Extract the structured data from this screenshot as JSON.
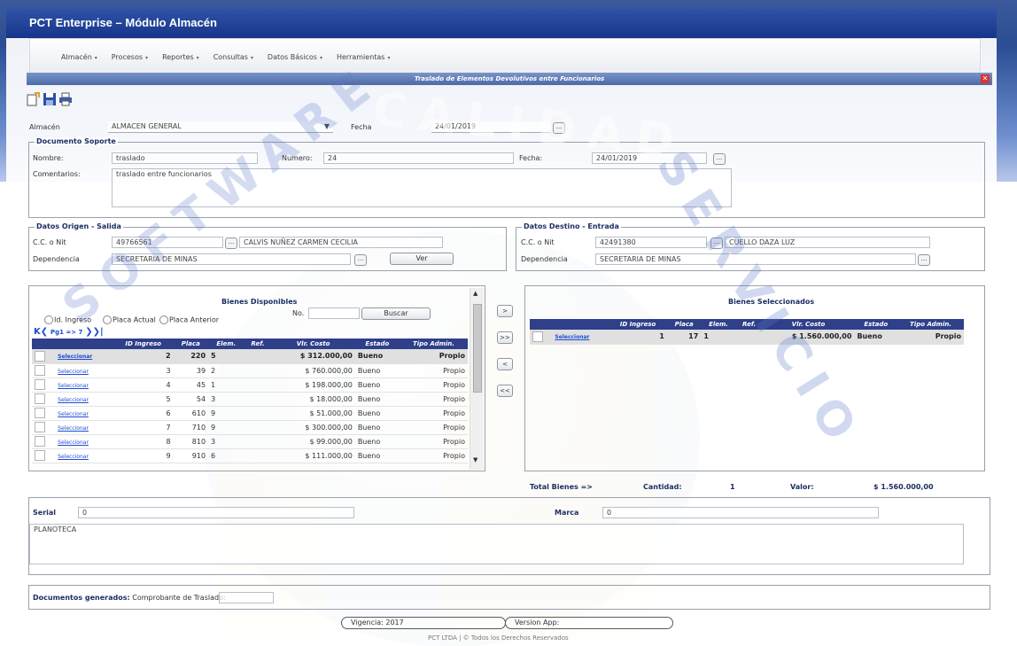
{
  "app": {
    "title": "PCT Enterprise – Módulo Almacén"
  },
  "menu": [
    {
      "label": "Almacén"
    },
    {
      "label": "Procesos"
    },
    {
      "label": "Reportes"
    },
    {
      "label": "Consultas"
    },
    {
      "label": "Datos Básicos"
    },
    {
      "label": "Herramientas"
    }
  ],
  "form": {
    "title": "Traslado de Elementos Devolutivos entre Funcionarios",
    "close": "✕",
    "almacen_label": "Almacén",
    "almacen_value": "ALMACEN GENERAL",
    "fecha_label": "Fecha",
    "fecha_value": "24/01/2019",
    "dots": "..."
  },
  "documento": {
    "legend": "Documento Soporte",
    "nombre_label": "Nombre:",
    "nombre_value": "traslado",
    "numero_label": "Numero:",
    "numero_value": "24",
    "fecha_label": "Fecha:",
    "fecha_value": "24/01/2019",
    "comentarios_label": "Comentarios:",
    "comentarios_value": "traslado entre funcionarios"
  },
  "origen": {
    "legend": "Datos Origen - Salida",
    "cc_label": "C.C. o Nit",
    "cc_value": "49766561",
    "nombre_value": "CALVIS NUÑEZ CARMEN CECILIA",
    "dep_label": "Dependencia",
    "dep_value": "SECRETARIA DE MINAS",
    "ver_button": "Ver"
  },
  "destino": {
    "legend": "Datos Destino - Entrada",
    "cc_label": "C.C. o Nit",
    "cc_value": "42491380",
    "nombre_value": "CUELLO DAZA LUZ",
    "dep_label": "Dependencia",
    "dep_value": "SECRETARIA DE MINAS"
  },
  "disponibles": {
    "title": "Bienes Disponibles",
    "radios": [
      "Id. Ingreso",
      "Placa Actual",
      "Placa Anterior"
    ],
    "no_label": "No.",
    "buscar_button": "Buscar",
    "pager": "Pg1 => 7",
    "columns": [
      "",
      "",
      "ID Ingreso",
      "Placa",
      "Elem.",
      "Ref.",
      "Vlr. Costo",
      "Estado",
      "Tipo Admin."
    ],
    "rows": [
      {
        "link": "Seleccionar",
        "id": "2",
        "placa": "220",
        "elem": "5",
        "ref": "",
        "costo": "$ 312.000,00",
        "estado": "Bueno",
        "tipo": "Propio",
        "checked": true
      },
      {
        "link": "Seleccionar",
        "id": "3",
        "placa": "39",
        "elem": "2",
        "ref": "",
        "costo": "$ 760.000,00",
        "estado": "Bueno",
        "tipo": "Propio",
        "checked": false
      },
      {
        "link": "Seleccionar",
        "id": "4",
        "placa": "45",
        "elem": "1",
        "ref": "",
        "costo": "$ 198.000,00",
        "estado": "Bueno",
        "tipo": "Propio",
        "checked": false
      },
      {
        "link": "Seleccionar",
        "id": "5",
        "placa": "54",
        "elem": "3",
        "ref": "",
        "costo": "$ 18.000,00",
        "estado": "Bueno",
        "tipo": "Propio",
        "checked": false
      },
      {
        "link": "Seleccionar",
        "id": "6",
        "placa": "610",
        "elem": "9",
        "ref": "",
        "costo": "$ 51.000,00",
        "estado": "Bueno",
        "tipo": "Propio",
        "checked": false
      },
      {
        "link": "Seleccionar",
        "id": "7",
        "placa": "710",
        "elem": "9",
        "ref": "",
        "costo": "$ 300.000,00",
        "estado": "Bueno",
        "tipo": "Propio",
        "checked": false
      },
      {
        "link": "Seleccionar",
        "id": "8",
        "placa": "810",
        "elem": "3",
        "ref": "",
        "costo": "$ 99.000,00",
        "estado": "Bueno",
        "tipo": "Propio",
        "checked": false
      },
      {
        "link": "Seleccionar",
        "id": "9",
        "placa": "910",
        "elem": "6",
        "ref": "",
        "costo": "$ 111.000,00",
        "estado": "Bueno",
        "tipo": "Propio",
        "checked": false
      }
    ]
  },
  "transfer": {
    "move_one": ">",
    "move_all": ">>",
    "back_one": "<",
    "back_all": "<<"
  },
  "seleccionados": {
    "title": "Bienes Seleccionados",
    "columns": [
      "",
      "",
      "ID Ingreso",
      "Placa",
      "Elem.",
      "Ref.",
      "Vlr. Costo",
      "Estado",
      "Tipo Admin."
    ],
    "rows": [
      {
        "link": "Seleccionar",
        "id": "1",
        "placa": "17",
        "elem": "1",
        "ref": "",
        "costo": "$ 1.560.000,00",
        "estado": "Bueno",
        "tipo": "Propio"
      }
    ]
  },
  "totales": {
    "total_label": "Total Bienes =>",
    "cantidad_label": "Cantidad:",
    "cantidad_value": "1",
    "valor_label": "Valor:",
    "valor_value": "$ 1.560.000,00"
  },
  "detalle": {
    "serial_label": "Serial",
    "serial_value": "0",
    "marca_label": "Marca",
    "marca_value": "0",
    "descripcion": "PLANOTECA"
  },
  "documentos": {
    "label": "Documentos generados:",
    "comprobante_label": "Comprobante de Traslado:"
  },
  "footer": {
    "vigencia": "Vigencia: 2017",
    "version": "Version App:",
    "copyright": "PCT LTDA | © Todos los Derechos Reservados"
  },
  "watermark": {
    "calidad": "CALIDAD",
    "software": "SOFTWARE",
    "servicio": "SERVICIO"
  },
  "colors": {
    "titlebar": "#17358a",
    "grid_header": "#2f3f8a",
    "link": "#1e4bd2",
    "close": "#dd3333"
  }
}
